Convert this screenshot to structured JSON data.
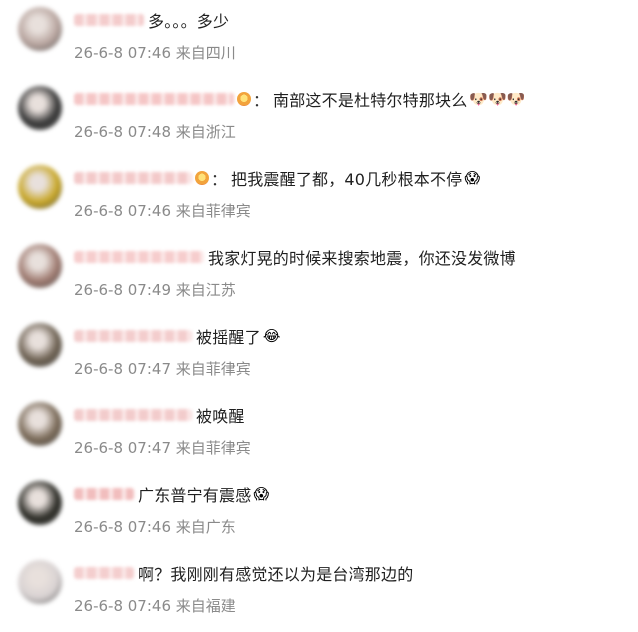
{
  "comments": [
    {
      "text": "多。。。多少",
      "time": "26-6-8 07:46",
      "loc": "来自四川",
      "emoji": "",
      "badge": false,
      "colon": false,
      "avatar_color": "#b9a6a0",
      "nick_w": 70,
      "nick_color": "#f3c7c7"
    },
    {
      "text": "南部这不是杜特尔特那块么",
      "time": "26-6-8 07:48",
      "loc": "来自浙江",
      "emoji": "🐶🐶🐶",
      "badge": true,
      "colon": true,
      "avatar_color": "#3a3a3a",
      "nick_w": 160,
      "nick_color": "#f4c0c0"
    },
    {
      "text": "把我震醒了都，40几秒根本不停",
      "time": "26-6-8 07:46",
      "loc": "来自菲律宾",
      "emoji": "😱",
      "badge": true,
      "colon": true,
      "avatar_color": "#c9a82a",
      "nick_w": 118,
      "nick_color": "#f2c4c4"
    },
    {
      "text": "我家灯晃的时候来搜索地震，你还没发微博",
      "time": "26-6-8 07:49",
      "loc": "来自江苏",
      "emoji": "",
      "badge": false,
      "colon": false,
      "avatar_color": "#a07c72",
      "nick_w": 130,
      "nick_color": "#f6c8c8"
    },
    {
      "text": "被摇醒了",
      "time": "26-6-8 07:47",
      "loc": "来自菲律宾",
      "emoji": "😂",
      "badge": false,
      "colon": false,
      "avatar_color": "#6f6354",
      "nick_w": 118,
      "nick_color": "#f2c8c8"
    },
    {
      "text": "被唤醒",
      "time": "26-6-8 07:47",
      "loc": "来自菲律宾",
      "emoji": "",
      "badge": false,
      "colon": false,
      "avatar_color": "#7b6b59",
      "nick_w": 118,
      "nick_color": "#f1c6c6"
    },
    {
      "text": "广东普宁有震感",
      "time": "26-6-8 07:46",
      "loc": "来自广东",
      "emoji": "😱",
      "badge": false,
      "colon": false,
      "avatar_color": "#2e2e28",
      "nick_w": 60,
      "nick_color": "#f0b6b6"
    },
    {
      "text": "啊？我刚刚有感觉还以为是台湾那边的",
      "time": "26-6-8 07:46",
      "loc": "来自福建",
      "emoji": "",
      "badge": false,
      "colon": false,
      "avatar_color": "#d9d3d3",
      "nick_w": 60,
      "nick_color": "#f3c9c9"
    }
  ]
}
